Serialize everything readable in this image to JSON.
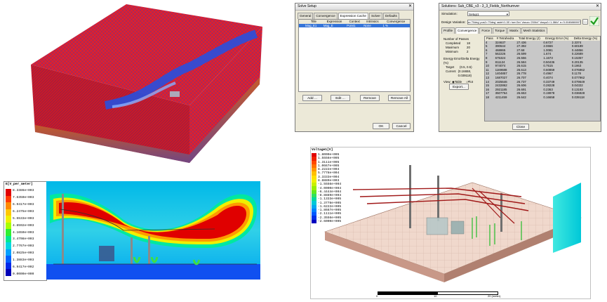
{
  "solve_setup": {
    "title": "Solve Setup",
    "tabs": [
      "General",
      "Convergence",
      "Expression Cache",
      "Solver",
      "Defaults"
    ],
    "active_tab": "Expression Cache",
    "columns": [
      "Title",
      "Expression",
      "Context",
      "Intrinsics",
      "Convergence"
    ],
    "row": [
      "Mag_E1",
      "Mag_E",
      "Point1",
      "None",
      "1 %"
    ],
    "buttons": {
      "add": "Add ...",
      "edit": "Edit ...",
      "remove": "Remove",
      "remove_all": "Remove All"
    },
    "ok": "OK",
    "cancel": "Cancel"
  },
  "solutions": {
    "title": "Solutions: Sub_CBE_v3 - 3_3_Fields_Northumver",
    "simulation_label": "Simulation:",
    "simulation_value": "Setup1",
    "design_variation_label": "Design Variation:",
    "design_variation_value": "a='70deg' pos2='70deg' radeh'1.35' r'sen'3m' Vaxux='200kV' Vaxys2='1.38kV' e='0.0045880007'",
    "tabs": [
      "Profile",
      "Convergence",
      "Force",
      "Torque",
      "Matrix",
      "Mesh Statistics"
    ],
    "active_tab": "Convergence",
    "number_of_passes_label": "Number of Passes",
    "completed_label": "Completed",
    "completed": "18",
    "maximum_label": "Maximum",
    "maximum": "20",
    "minimum_label": "Minimum",
    "minimum": "2",
    "energy_label": "Energy Error/Delta Energy (%)",
    "target_label": "Target",
    "target": "(0.5, 0.5)",
    "current_label": "Current",
    "current": "(0.16658, 0.039118)",
    "view_label": "View:",
    "view_table": "Table",
    "view_plot": "Plot",
    "export": "Export...",
    "close": "Close",
    "columns": [
      "Pass",
      "# Tetrahedra",
      "Total Energy (J)",
      "Energy Error (%)",
      "Delta Energy (%)"
    ],
    "rows": [
      [
        "4",
        "324637",
        "27.436",
        "0.6727",
        "2.3374"
      ],
      [
        "5",
        "390644",
        "27.392",
        "2.0666",
        "0.60189"
      ],
      [
        "6",
        "468865",
        "27.68",
        "1.0081",
        "0.44856"
      ],
      [
        "7",
        "562226",
        "26.599",
        "1.674",
        "0.22689"
      ],
      [
        "8",
        "675324",
        "26.556",
        "1.1673",
        "0.15357"
      ],
      [
        "9",
        "811124",
        "26.584",
        "0.50436",
        "0.20135"
      ],
      [
        "10",
        "974074",
        "26.615",
        "0.7515",
        "0.1863"
      ],
      [
        "11",
        "1169688",
        "26.613",
        "0.60859",
        "0.076962"
      ],
      [
        "12",
        "1404857",
        "26.778",
        "0.4967",
        "0.1178"
      ],
      [
        "13",
        "1687027",
        "26.707",
        "0.4074",
        "0.077962"
      ],
      [
        "14",
        "2025646",
        "26.737",
        "0.33749",
        "0.079649"
      ],
      [
        "15",
        "2432862",
        "26.606",
        "0.28228",
        "0.04322"
      ],
      [
        "16",
        "2921185",
        "26.691",
        "0.2363",
        "0.13193"
      ],
      [
        "17",
        "3507764",
        "26.653",
        "0.19978",
        "0.036928"
      ],
      [
        "18",
        "4211459",
        "26.642",
        "0.16658",
        "0.039118"
      ]
    ]
  },
  "field_legend": {
    "title": "E[V_per_meter]",
    "values": [
      "8.3386e+003",
      "7.6350e+003",
      "6.9417e+003",
      "6.2475e+003",
      "5.5533e+003",
      "4.8592e+003",
      "4.1650e+003",
      "3.4708e+003",
      "2.7767e+003",
      "2.0825e+003",
      "1.3883e+003",
      "6.9417e+002",
      "0.0000e+000"
    ],
    "colors": [
      "#e00000",
      "#ff3a00",
      "#ff8a00",
      "#ffc800",
      "#f0f000",
      "#a8ff00",
      "#30f030",
      "#00e890",
      "#00d8e0",
      "#00a0ff",
      "#0060ff",
      "#0028e8",
      "#0000b8"
    ]
  },
  "voltage_legend": {
    "title": "Voltage1[V]",
    "values": [
      "1.8000e+005",
      "1.5556e+005",
      "1.3111e+005",
      "1.0667e+005",
      "8.2222e+004",
      "5.7778e+004",
      "3.3333e+004",
      "8.8889e+003",
      "-1.5556e+004",
      "-4.0000e+004",
      "-6.4444e+004",
      "-8.8889e+004",
      "-1.1333e+005",
      "-1.3778e+005",
      "-1.6222e+005",
      "-1.8667e+005",
      "-2.1111e+005",
      "-2.3556e+005",
      "-2.6000e+005"
    ],
    "colors": [
      "#e00000",
      "#f02000",
      "#ff4800",
      "#ff7000",
      "#ff9800",
      "#ffc000",
      "#ffe000",
      "#f0f000",
      "#c8f000",
      "#98f000",
      "#60e820",
      "#30e060",
      "#00d8a0",
      "#00c8d8",
      "#00a8f0",
      "#0080ff",
      "#0058ff",
      "#0030e8",
      "#0000c0"
    ]
  },
  "scale_bar": {
    "labels": [
      "0",
      "10",
      "20 (meter)"
    ]
  },
  "colors": {
    "mesh_red": "#e0202c",
    "mesh_blue": "#1f52e8",
    "window_bg": "#ece9d8",
    "selection": "#3574d8"
  }
}
